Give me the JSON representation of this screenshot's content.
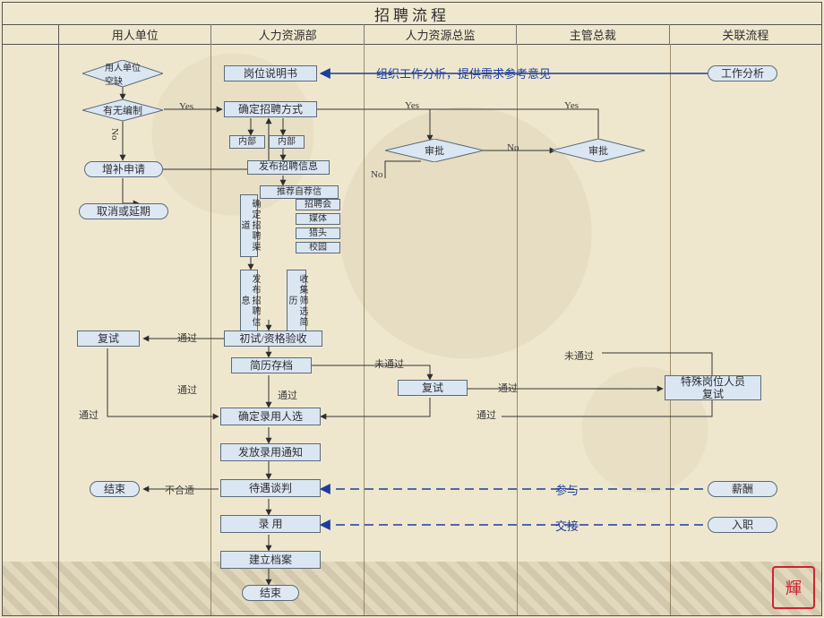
{
  "title": "招聘流程",
  "lanes": [
    "用人单位",
    "人力资源部",
    "人力资源总监",
    "主管总裁",
    "关联流程"
  ],
  "labels": {
    "yes": "Yes",
    "no": "No",
    "no_v": "No",
    "pass": "通过",
    "not_pass": "未通过",
    "not_suit": "不合适",
    "analysis_note": "组织工作分析，提供需求参考意见",
    "participate": "参与",
    "handover": "交接"
  },
  "nodes": {
    "d_vacancy": "用人单位\n空缺",
    "d_headcount": "有无编制",
    "t_supp_apply": "增补申请",
    "t_cancel": "取消或延期",
    "p_jobspec": "岗位说明书",
    "p_method": "确定招聘方式",
    "p_internal1": "内部",
    "p_internal2": "内部",
    "p_publish": "发布招聘信息",
    "p_reco": "推荐自荐信",
    "p_ch_fair": "招聘会",
    "p_ch_media": "媒体",
    "p_ch_head": "猎头",
    "p_ch_campus": "校园",
    "v_channel": "确定招聘渠道",
    "v_dispatch": "发布招聘信息",
    "v_collect": "收集筛选简历",
    "p_screen": "初试/资格验收",
    "p_resume_file": "简历存档",
    "p_retest_a": "复试",
    "p_retest_b": "复试",
    "p_special": "特殊岗位人员\n复试",
    "p_decide": "确定录用人选",
    "p_offer": "发放录用通知",
    "p_negotiate": "待遇谈判",
    "p_hire": "录    用",
    "p_file": "建立档案",
    "t_end1": "结束",
    "t_end2": "结束",
    "d_approve1": "审批",
    "d_approve2": "审批",
    "p_wa": "工作分析",
    "p_salary": "薪酬",
    "p_onboard": "入职"
  }
}
